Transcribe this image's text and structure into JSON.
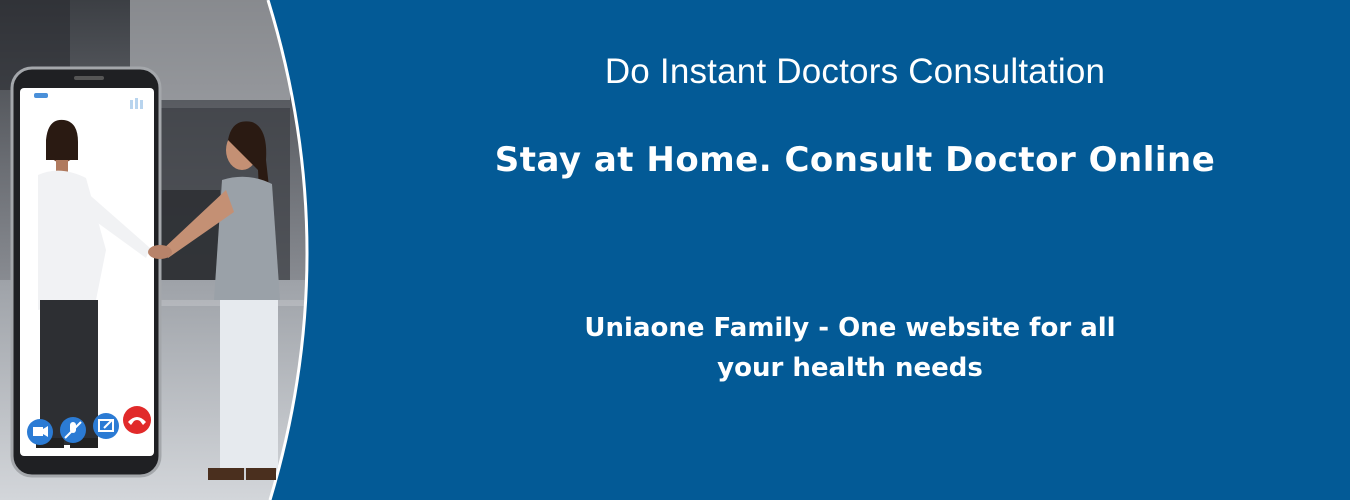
{
  "banner": {
    "headline": "Do Instant Doctors Consultation",
    "subheadline": "Stay at Home. Consult Doctor Online",
    "tagline_line1": "Uniaone Family - One website for all",
    "tagline_line2": "your health needs"
  },
  "colors": {
    "background": "#035a96",
    "text": "#ffffff",
    "call_button": "#2b7bd4",
    "end_call_button": "#e12a2a"
  },
  "phone": {
    "call_controls": [
      "video-camera-icon",
      "mute-microphone-icon",
      "screen-share-icon",
      "end-call-icon"
    ]
  }
}
